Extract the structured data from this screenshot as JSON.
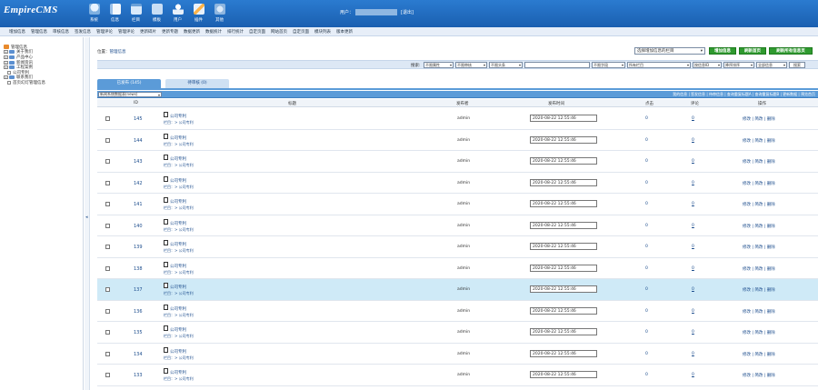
{
  "app": {
    "logo": "EmpireCMS"
  },
  "topnav": [
    {
      "label": "系统",
      "icon": "database-icon"
    },
    {
      "label": "信息",
      "icon": "document-edit-icon"
    },
    {
      "label": "栏目",
      "icon": "folder-icon"
    },
    {
      "label": "模板",
      "icon": "template-icon"
    },
    {
      "label": "用户",
      "icon": "user-icon"
    },
    {
      "label": "插件",
      "icon": "plugin-icon"
    },
    {
      "label": "其他",
      "icon": "gear-icon"
    }
  ],
  "user": {
    "label": "用户：",
    "logout": "[退出]"
  },
  "subnav": [
    "增加信息",
    "管理信息",
    "审核信息",
    "签发信息",
    "管理评论",
    "管理评论",
    "更新碎片",
    "更新专题",
    "数据更新",
    "数据统计",
    "排行统计",
    "自定页面",
    "网站首页",
    "自定页面",
    "模块列表",
    "版本更新"
  ],
  "sidebar": {
    "root": "管理信息",
    "items": [
      {
        "label": "关于我们",
        "type": "folder",
        "level": 1
      },
      {
        "label": "产品中心",
        "type": "folder",
        "level": 1
      },
      {
        "label": "新闻资讯",
        "type": "folder",
        "level": 1
      },
      {
        "label": "工程案例",
        "type": "folder",
        "level": 1
      },
      {
        "label": "公司专利",
        "type": "page",
        "level": 1
      },
      {
        "label": "联系我们",
        "type": "folder",
        "level": 1
      },
      {
        "label": "首页幻灯管理信息",
        "type": "page",
        "level": 2
      }
    ]
  },
  "location": {
    "prefix": "位置：",
    "link": "管理信息"
  },
  "column_select": {
    "value": "选择增加信息的栏目"
  },
  "buttons": {
    "add": "增加信息",
    "refresh_home": "刷新首页",
    "refresh_all": "刷新所有信息页"
  },
  "search": {
    "label": "搜索:",
    "flag": "不限属性",
    "check": "不限审核",
    "head": "不限头条",
    "keyword_value": "",
    "field": "不限字段",
    "column": "所有栏目",
    "sort": "按信息ID",
    "order": "降序排序",
    "all": "全部信息",
    "button": "搜索"
  },
  "tabs": {
    "published": "已发布 (145)",
    "drafts": "待审核 (0)"
  },
  "view_select": "新闻系统数据表(news)",
  "toollinks": "我的信息 | 签发信息 | 待审信息 | 查询重复标题A | 查询重复标题B | 更新数据 | 预览首页",
  "table": {
    "headers": {
      "id": "ID",
      "title": "标题",
      "publisher": "发布者",
      "time": "发布时间",
      "clicks": "点击",
      "comments": "评论",
      "ops": "操作"
    },
    "rows": [
      {
        "id": "145",
        "title": "公司专利",
        "category": "栏目：> 公司专利",
        "publisher": "admin",
        "time": "2020-08-22 12:55:46",
        "clicks": "0",
        "comments": "0",
        "ops": "修改 | 简改 | 删除"
      },
      {
        "id": "144",
        "title": "公司专利",
        "category": "栏目：> 公司专利",
        "publisher": "admin",
        "time": "2020-08-22 12:55:46",
        "clicks": "0",
        "comments": "0",
        "ops": "修改 | 简改 | 删除"
      },
      {
        "id": "143",
        "title": "公司专利",
        "category": "栏目：> 公司专利",
        "publisher": "admin",
        "time": "2020-08-22 12:55:46",
        "clicks": "0",
        "comments": "0",
        "ops": "修改 | 简改 | 删除"
      },
      {
        "id": "142",
        "title": "公司专利",
        "category": "栏目：> 公司专利",
        "publisher": "admin",
        "time": "2020-08-22 12:55:46",
        "clicks": "0",
        "comments": "0",
        "ops": "修改 | 简改 | 删除"
      },
      {
        "id": "141",
        "title": "公司专利",
        "category": "栏目：> 公司专利",
        "publisher": "admin",
        "time": "2020-08-22 12:55:46",
        "clicks": "0",
        "comments": "0",
        "ops": "修改 | 简改 | 删除"
      },
      {
        "id": "140",
        "title": "公司专利",
        "category": "栏目：> 公司专利",
        "publisher": "admin",
        "time": "2020-08-22 12:55:46",
        "clicks": "0",
        "comments": "0",
        "ops": "修改 | 简改 | 删除"
      },
      {
        "id": "139",
        "title": "公司专利",
        "category": "栏目：> 公司专利",
        "publisher": "admin",
        "time": "2020-08-22 12:55:46",
        "clicks": "0",
        "comments": "0",
        "ops": "修改 | 简改 | 删除"
      },
      {
        "id": "138",
        "title": "公司专利",
        "category": "栏目：> 公司专利",
        "publisher": "admin",
        "time": "2020-08-22 12:55:46",
        "clicks": "0",
        "comments": "0",
        "ops": "修改 | 简改 | 删除"
      },
      {
        "id": "137",
        "title": "公司专利",
        "category": "栏目：> 公司专利",
        "publisher": "admin",
        "time": "2020-08-22 12:55:46",
        "clicks": "0",
        "comments": "0",
        "ops": "修改 | 简改 | 删除",
        "highlight": true
      },
      {
        "id": "136",
        "title": "公司专利",
        "category": "栏目：> 公司专利",
        "publisher": "admin",
        "time": "2020-08-22 12:55:46",
        "clicks": "0",
        "comments": "0",
        "ops": "修改 | 简改 | 删除"
      },
      {
        "id": "135",
        "title": "公司专利",
        "category": "栏目：> 公司专利",
        "publisher": "admin",
        "time": "2020-08-22 12:55:46",
        "clicks": "0",
        "comments": "0",
        "ops": "修改 | 简改 | 删除"
      },
      {
        "id": "134",
        "title": "公司专利",
        "category": "栏目：> 公司专利",
        "publisher": "admin",
        "time": "2020-08-22 12:55:46",
        "clicks": "0",
        "comments": "0",
        "ops": "修改 | 简改 | 删除"
      },
      {
        "id": "133",
        "title": "公司专利",
        "category": "栏目：> 公司专利",
        "publisher": "admin",
        "time": "2020-08-22 12:55:46",
        "clicks": "0",
        "comments": "0",
        "ops": "修改 | 简改 | 删除"
      }
    ]
  }
}
